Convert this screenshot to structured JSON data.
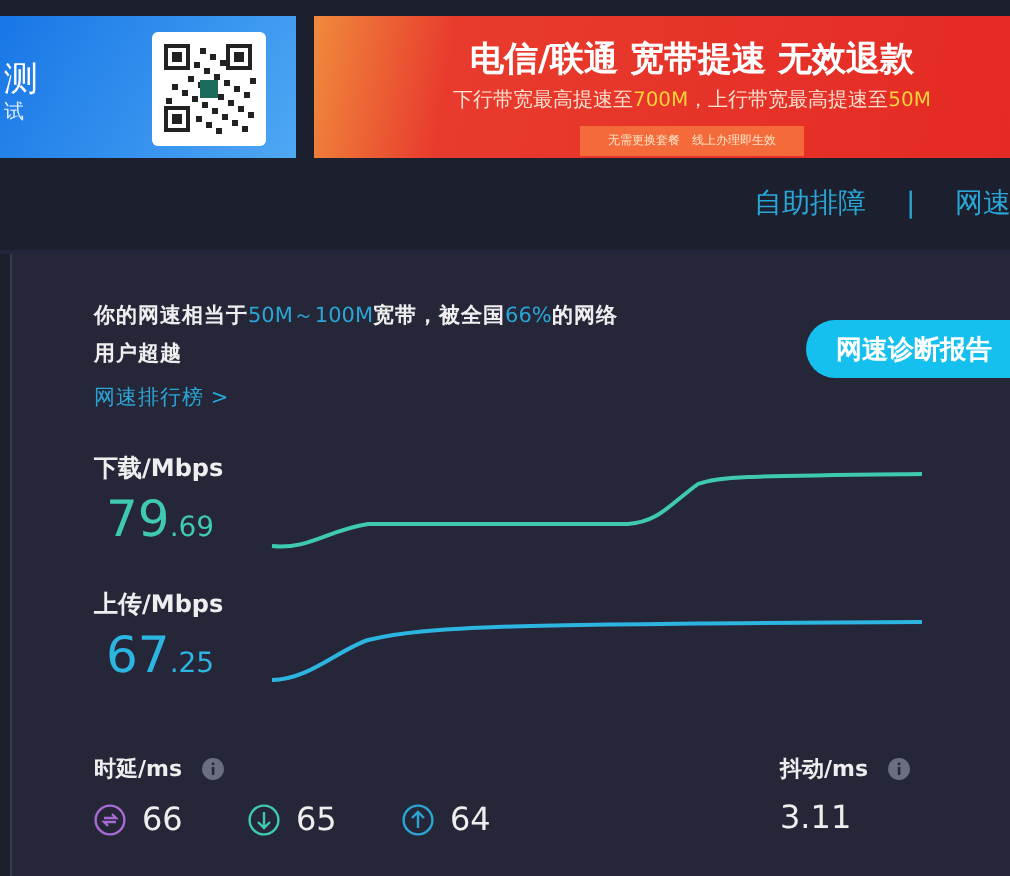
{
  "qr_panel": {
    "title": "测",
    "subtitle": "试"
  },
  "promo": {
    "title": "电信/联通 宽带提速 无效退款",
    "subtitle": [
      {
        "text": "下行带宽最高提速至",
        "highlight": false
      },
      {
        "text": "700M",
        "highlight": true
      },
      {
        "text": "，上行带宽最高提速至",
        "highlight": false
      },
      {
        "text": "50M",
        "highlight": true
      }
    ],
    "button": "无需更换套餐　线上办理即生效"
  },
  "nav": {
    "items": [
      "自助排障",
      "网速"
    ],
    "separator": "|"
  },
  "summary": {
    "sentence": [
      {
        "text": "你的网速相当于",
        "highlight": false
      },
      {
        "text": "50M～100M",
        "highlight": true
      },
      {
        "text": "宽带，被全国",
        "highlight": false
      },
      {
        "text": "66%",
        "highlight": true
      },
      {
        "text": "的网络用户超越",
        "highlight": false
      }
    ],
    "ranking_link": "网速排行榜 >",
    "report_button": "网速诊断报告"
  },
  "metrics": [
    {
      "kind": "download",
      "label": "下载/Mbps",
      "integer": "79",
      "decimal": ".69"
    },
    {
      "kind": "upload",
      "label": "上传/Mbps",
      "integer": "67",
      "decimal": ".25"
    }
  ],
  "latency": {
    "label": "时延/ms",
    "items": [
      {
        "kind": "both",
        "value": "66"
      },
      {
        "kind": "down",
        "value": "65"
      },
      {
        "kind": "up",
        "value": "64"
      }
    ]
  },
  "jitter": {
    "label": "抖动/ms",
    "value": "3.11"
  }
}
